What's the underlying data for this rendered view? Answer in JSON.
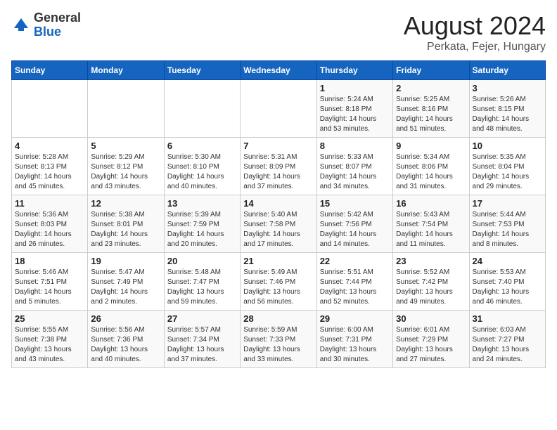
{
  "logo": {
    "general": "General",
    "blue": "Blue"
  },
  "title": "August 2024",
  "subtitle": "Perkata, Fejer, Hungary",
  "days_of_week": [
    "Sunday",
    "Monday",
    "Tuesday",
    "Wednesday",
    "Thursday",
    "Friday",
    "Saturday"
  ],
  "weeks": [
    [
      {
        "day": "",
        "info": ""
      },
      {
        "day": "",
        "info": ""
      },
      {
        "day": "",
        "info": ""
      },
      {
        "day": "",
        "info": ""
      },
      {
        "day": "1",
        "info": "Sunrise: 5:24 AM\nSunset: 8:18 PM\nDaylight: 14 hours\nand 53 minutes."
      },
      {
        "day": "2",
        "info": "Sunrise: 5:25 AM\nSunset: 8:16 PM\nDaylight: 14 hours\nand 51 minutes."
      },
      {
        "day": "3",
        "info": "Sunrise: 5:26 AM\nSunset: 8:15 PM\nDaylight: 14 hours\nand 48 minutes."
      }
    ],
    [
      {
        "day": "4",
        "info": "Sunrise: 5:28 AM\nSunset: 8:13 PM\nDaylight: 14 hours\nand 45 minutes."
      },
      {
        "day": "5",
        "info": "Sunrise: 5:29 AM\nSunset: 8:12 PM\nDaylight: 14 hours\nand 43 minutes."
      },
      {
        "day": "6",
        "info": "Sunrise: 5:30 AM\nSunset: 8:10 PM\nDaylight: 14 hours\nand 40 minutes."
      },
      {
        "day": "7",
        "info": "Sunrise: 5:31 AM\nSunset: 8:09 PM\nDaylight: 14 hours\nand 37 minutes."
      },
      {
        "day": "8",
        "info": "Sunrise: 5:33 AM\nSunset: 8:07 PM\nDaylight: 14 hours\nand 34 minutes."
      },
      {
        "day": "9",
        "info": "Sunrise: 5:34 AM\nSunset: 8:06 PM\nDaylight: 14 hours\nand 31 minutes."
      },
      {
        "day": "10",
        "info": "Sunrise: 5:35 AM\nSunset: 8:04 PM\nDaylight: 14 hours\nand 29 minutes."
      }
    ],
    [
      {
        "day": "11",
        "info": "Sunrise: 5:36 AM\nSunset: 8:03 PM\nDaylight: 14 hours\nand 26 minutes."
      },
      {
        "day": "12",
        "info": "Sunrise: 5:38 AM\nSunset: 8:01 PM\nDaylight: 14 hours\nand 23 minutes."
      },
      {
        "day": "13",
        "info": "Sunrise: 5:39 AM\nSunset: 7:59 PM\nDaylight: 14 hours\nand 20 minutes."
      },
      {
        "day": "14",
        "info": "Sunrise: 5:40 AM\nSunset: 7:58 PM\nDaylight: 14 hours\nand 17 minutes."
      },
      {
        "day": "15",
        "info": "Sunrise: 5:42 AM\nSunset: 7:56 PM\nDaylight: 14 hours\nand 14 minutes."
      },
      {
        "day": "16",
        "info": "Sunrise: 5:43 AM\nSunset: 7:54 PM\nDaylight: 14 hours\nand 11 minutes."
      },
      {
        "day": "17",
        "info": "Sunrise: 5:44 AM\nSunset: 7:53 PM\nDaylight: 14 hours\nand 8 minutes."
      }
    ],
    [
      {
        "day": "18",
        "info": "Sunrise: 5:46 AM\nSunset: 7:51 PM\nDaylight: 14 hours\nand 5 minutes."
      },
      {
        "day": "19",
        "info": "Sunrise: 5:47 AM\nSunset: 7:49 PM\nDaylight: 14 hours\nand 2 minutes."
      },
      {
        "day": "20",
        "info": "Sunrise: 5:48 AM\nSunset: 7:47 PM\nDaylight: 13 hours\nand 59 minutes."
      },
      {
        "day": "21",
        "info": "Sunrise: 5:49 AM\nSunset: 7:46 PM\nDaylight: 13 hours\nand 56 minutes."
      },
      {
        "day": "22",
        "info": "Sunrise: 5:51 AM\nSunset: 7:44 PM\nDaylight: 13 hours\nand 52 minutes."
      },
      {
        "day": "23",
        "info": "Sunrise: 5:52 AM\nSunset: 7:42 PM\nDaylight: 13 hours\nand 49 minutes."
      },
      {
        "day": "24",
        "info": "Sunrise: 5:53 AM\nSunset: 7:40 PM\nDaylight: 13 hours\nand 46 minutes."
      }
    ],
    [
      {
        "day": "25",
        "info": "Sunrise: 5:55 AM\nSunset: 7:38 PM\nDaylight: 13 hours\nand 43 minutes."
      },
      {
        "day": "26",
        "info": "Sunrise: 5:56 AM\nSunset: 7:36 PM\nDaylight: 13 hours\nand 40 minutes."
      },
      {
        "day": "27",
        "info": "Sunrise: 5:57 AM\nSunset: 7:34 PM\nDaylight: 13 hours\nand 37 minutes."
      },
      {
        "day": "28",
        "info": "Sunrise: 5:59 AM\nSunset: 7:33 PM\nDaylight: 13 hours\nand 33 minutes."
      },
      {
        "day": "29",
        "info": "Sunrise: 6:00 AM\nSunset: 7:31 PM\nDaylight: 13 hours\nand 30 minutes."
      },
      {
        "day": "30",
        "info": "Sunrise: 6:01 AM\nSunset: 7:29 PM\nDaylight: 13 hours\nand 27 minutes."
      },
      {
        "day": "31",
        "info": "Sunrise: 6:03 AM\nSunset: 7:27 PM\nDaylight: 13 hours\nand 24 minutes."
      }
    ]
  ]
}
